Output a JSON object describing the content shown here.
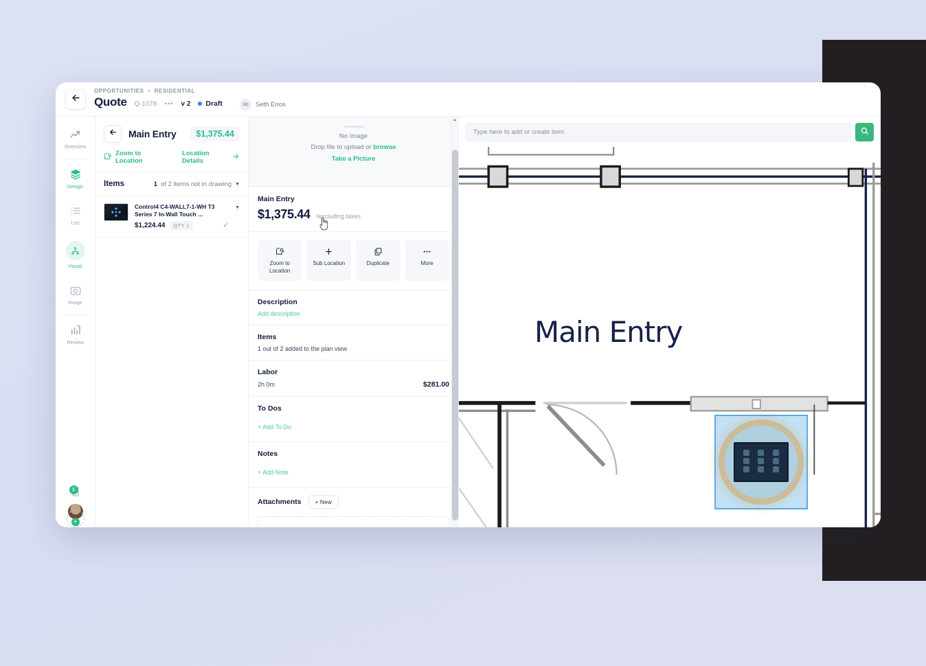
{
  "window": {
    "topbar": {
      "back_icon": "arrow-left-icon",
      "breadcrumb": {
        "root": "OPPORTUNITIES",
        "separator": ">",
        "leaf": "RESIDENTIAL"
      },
      "page_title": "Quote",
      "quote_number": "Q-1078",
      "dots": "•••",
      "version": "v 2",
      "status": "Draft",
      "status_color": "#2f80ed",
      "user_initials": "SE",
      "user_name": "Seth Enos"
    }
  },
  "rail": {
    "items": [
      {
        "label": "Overview",
        "icon": "trend-up-icon",
        "state": "default"
      },
      {
        "label": "Design",
        "icon": "layers-icon",
        "state": "green"
      },
      {
        "label": "List",
        "icon": "list-icon",
        "state": "default"
      },
      {
        "label": "Visual",
        "icon": "sitemap-icon",
        "state": "selected"
      },
      {
        "label": "Image",
        "icon": "camera-icon",
        "state": "default"
      },
      {
        "label": "Review",
        "icon": "bar-chart-icon",
        "state": "default"
      }
    ],
    "notification_count": "1",
    "notification_icon": "task-check-icon",
    "avatar_icon": "user-avatar",
    "add_icon": "plus-icon"
  },
  "location_panel": {
    "back_icon": "arrow-left-icon",
    "name": "Main Entry",
    "price": "$1,375.44",
    "zoom_to_location": {
      "label": "Zoom to Location",
      "icon": "zoom-location-icon"
    },
    "location_details": {
      "label": "Location Details",
      "icon": "arrow-right-icon"
    },
    "items_label": "Items",
    "items_filter_count": "1",
    "items_filter_text": "of 2 items not in drawing",
    "items": [
      {
        "title": "Control4 C4-WALL7-1-WH T3 Series 7 In-Wall Touch ...",
        "price": "$1,224.44",
        "qty": "QTY 1",
        "in_drawing": true,
        "thumbnail": "touchscreen-thumbnail"
      }
    ]
  },
  "collapse_handle": {
    "icon": "chevron-double-left-icon"
  },
  "detail_panel": {
    "dropzone": {
      "no_image": "No Image",
      "drop_prefix": "Drop file to upload or ",
      "browse": "browse",
      "take_picture": "Take a Picture"
    },
    "name": "Main Entry",
    "price": "$1,375.44",
    "price_sub": "/excluding taxes",
    "quick_actions": [
      {
        "label": "Zoom to Location",
        "icon": "zoom-location-icon"
      },
      {
        "label": "Sub Location",
        "icon": "plus-icon"
      },
      {
        "label": "Duplicate",
        "icon": "copy-icon"
      },
      {
        "label": "More",
        "icon": "ellipsis-icon"
      }
    ],
    "sections": {
      "description": {
        "heading": "Description",
        "link": "Add description"
      },
      "items": {
        "heading": "Items",
        "sub": "1 out of 2 added to the plan view"
      },
      "labor": {
        "heading": "Labor",
        "sub": "2h 0m",
        "amount": "$281.00"
      },
      "todos": {
        "heading": "To Dos",
        "link": "+ Add To Do"
      },
      "notes": {
        "heading": "Notes",
        "link": "+ Add Note"
      },
      "attachments": {
        "heading": "Attachments",
        "new_label": "+ New"
      }
    }
  },
  "plan": {
    "search_placeholder": "Type here to add or create item",
    "search_icon": "search-icon",
    "search_button_color": "#3bb77e",
    "room_label": "Main Entry",
    "selected_device": "touchscreen-device-marker"
  }
}
